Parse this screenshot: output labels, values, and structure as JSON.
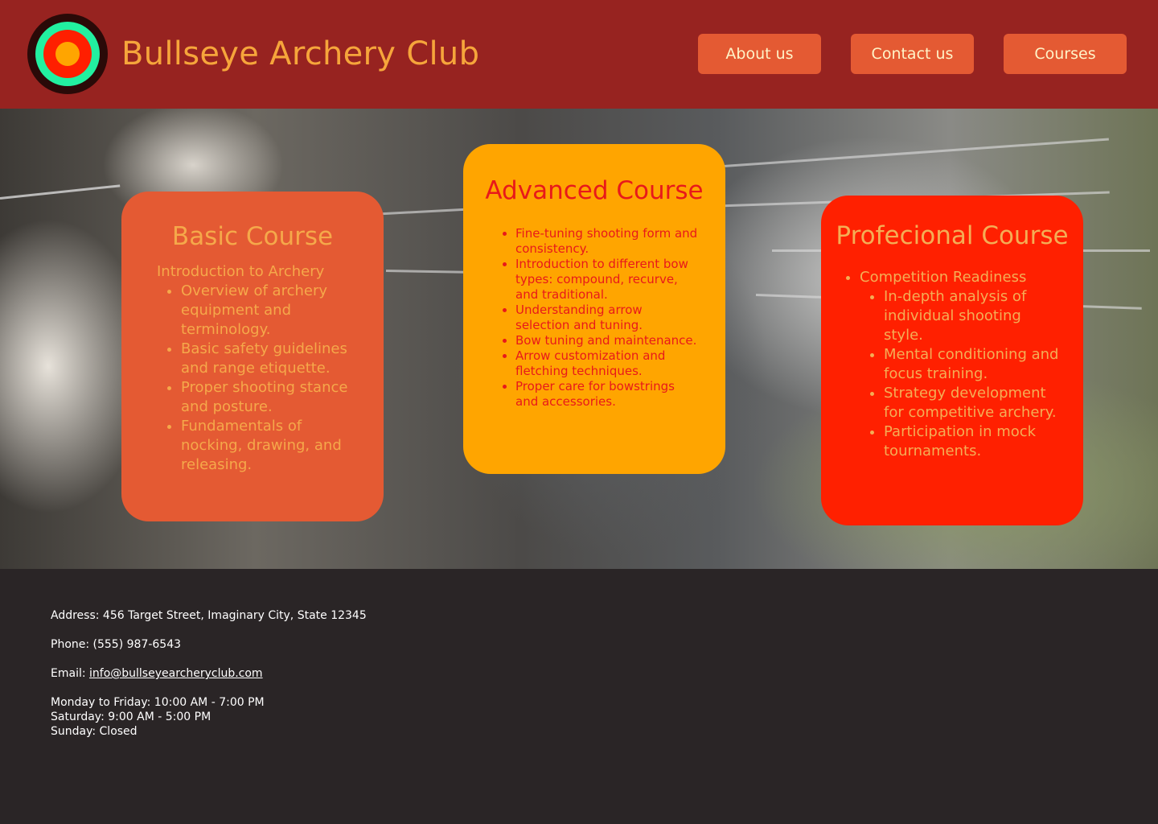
{
  "header": {
    "title": "Bullseye Archery Club",
    "nav": [
      "About us",
      "Contact us",
      "Courses"
    ]
  },
  "colors": {
    "header_bg": "#972320",
    "logo_outer": "#2a0a08",
    "logo_ring": "#22f0a0",
    "logo_red": "#ff1f00",
    "logo_center": "#ffa500",
    "nav_button": "#e45a33",
    "footer_bg": "#2a2526"
  },
  "courses": {
    "basic": {
      "title": "Basic Course",
      "intro": "Introduction to Archery",
      "items": [
        "Overview of archery equipment and terminology.",
        "Basic safety guidelines and range etiquette.",
        "Proper shooting stance and posture.",
        "Fundamentals of nocking, drawing, and releasing."
      ]
    },
    "advanced": {
      "title": "Advanced Course",
      "items": [
        "Fine-tuning shooting form and consistency.",
        "Introduction to different bow types: compound, recurve, and traditional.",
        "Understanding arrow selection and tuning.",
        "Bow tuning and maintenance.",
        "Arrow customization and fletching techniques.",
        "Proper care for bowstrings and accessories."
      ]
    },
    "professional": {
      "title": "Profecional Course",
      "heading": "Competition Readiness",
      "items": [
        "In-depth analysis of individual shooting style.",
        "Mental conditioning and focus training.",
        "Strategy development for competitive archery.",
        "Participation in mock tournaments."
      ]
    }
  },
  "footer": {
    "address": "Address: 456 Target Street, Imaginary City, State 12345",
    "phone": "Phone: (555) 987-6543",
    "email_label": "Email: ",
    "email": "info@bullseyearcheryclub.com",
    "hours": [
      "Monday to Friday: 10:00 AM - 7:00 PM",
      "Saturday: 9:00 AM - 5:00 PM",
      "Sunday: Closed"
    ]
  }
}
